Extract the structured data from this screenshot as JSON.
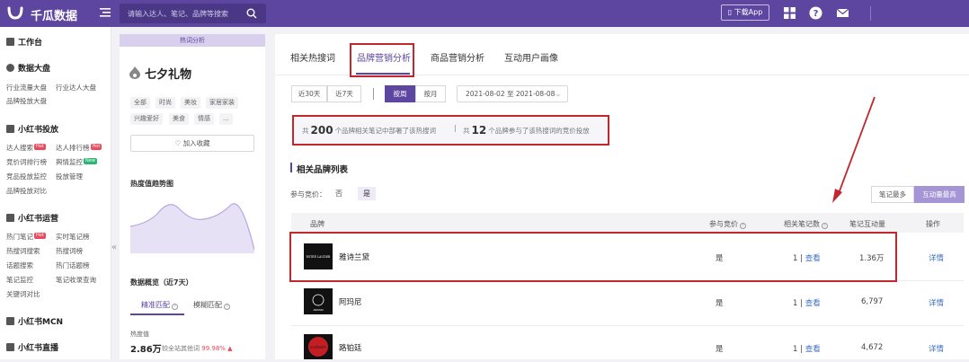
{
  "colors": {
    "brand": "#5d46a0",
    "annotation": "#c0282d",
    "link": "#3d6fc2",
    "up": "#e94b5e"
  },
  "topbar": {
    "logo_text": "千瓜数据",
    "search_placeholder": "请输入达人、笔记、品牌等搜索",
    "download_app": "下载App",
    "icons": [
      "menu-icon",
      "search-icon",
      "phone-icon",
      "grid-icon",
      "help-icon",
      "mail-icon"
    ]
  },
  "sidebar": {
    "workbench": "工作台",
    "data_board": {
      "title": "数据大盘",
      "links": [
        "行业流量大盘",
        "行业达人大盘",
        "品牌投放大盘"
      ]
    },
    "xhs_ads": {
      "title": "小红书投放",
      "links": [
        "达人搜索",
        "达人排行榜",
        "竞价词排行榜",
        "舆情监控",
        "竞品投放监控",
        "投放管理",
        "品牌投放对比"
      ]
    },
    "xhs_ops": {
      "title": "小红书运营",
      "links": [
        "热门笔记",
        "实时笔记榜",
        "热搜词搜索",
        "热搜词榜",
        "话题搜索",
        "热门话题榜",
        "笔记监控",
        "笔记收录查询",
        "关键词对比"
      ]
    },
    "mcn": "小红书MCN",
    "live": "小红书直播",
    "badges": {
      "hot": "Hot",
      "new": "New"
    },
    "collapse": "«"
  },
  "panel": {
    "tag": "热词分析",
    "keyword": "七夕礼物",
    "chips": [
      "全部",
      "时尚",
      "美妆",
      "家居家装",
      "兴趣爱好",
      "美食",
      "情感",
      "..."
    ],
    "fav_button": "加入收藏",
    "trend_title": "热度值趋势图",
    "overview_title": "数据概览（近7天）",
    "tabs": [
      "精准匹配",
      "模糊匹配"
    ],
    "metric_label": "热度值",
    "metric_value": "2.86万",
    "metric_compare_label": "较全站其他词",
    "metric_compare_pct": "99.98%"
  },
  "main": {
    "tabs": [
      "相关热搜词",
      "品牌营销分析",
      "商品营销分析",
      "互动用户画像"
    ],
    "active_tab": 1,
    "range_buttons": [
      "近30天",
      "近7天"
    ],
    "period_buttons": [
      "按周",
      "按月"
    ],
    "date_range": "2021-08-02 至 2021-08-08",
    "summary": {
      "p1": "共",
      "brand_count": "200",
      "p2": "个品牌相关笔记中部署了该热搜词",
      "sep": "|",
      "p3": "共",
      "bid_count": "12",
      "p4": "个品牌参与了该热搜词的竞价投放"
    },
    "section_title": "相关品牌列表",
    "filter_label": "参与竞价：",
    "filter_options": [
      "否",
      "是"
    ],
    "sort_buttons": [
      "笔记最多",
      "互动量最高"
    ],
    "columns": [
      "品牌",
      "参与竞价",
      "相关笔记数",
      "笔记互动量",
      "操作"
    ],
    "rows": [
      {
        "brand": "雅诗兰黛",
        "logo": "ESTEE LAUDER",
        "bid": "是",
        "notes": "1",
        "view": "查看",
        "interactions": "1.36万",
        "action": "详情"
      },
      {
        "brand": "阿玛尼",
        "logo": "ARMANI",
        "bid": "是",
        "notes": "1",
        "view": "查看",
        "interactions": "6,797",
        "action": "详情"
      },
      {
        "brand": "路铂廷",
        "logo": "Louboutin",
        "bid": "是",
        "notes": "1",
        "view": "查看",
        "interactions": "4,672",
        "action": "详情"
      }
    ],
    "pipe": "|"
  }
}
